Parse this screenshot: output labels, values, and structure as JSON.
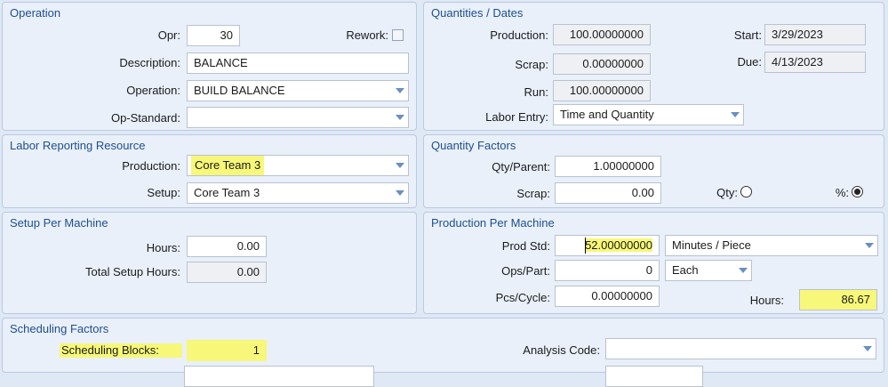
{
  "operation": {
    "title": "Operation",
    "opr_label": "Opr:",
    "opr_value": "30",
    "rework_label": "Rework:",
    "description_label": "Description:",
    "description_value": "BALANCE",
    "operation_label": "Operation:",
    "operation_value": "BUILD BALANCE",
    "op_standard_label": "Op-Standard:",
    "op_standard_value": ""
  },
  "quantities_dates": {
    "title": "Quantities / Dates",
    "production_label": "Production:",
    "production_value": "100.00000000",
    "scrap_label": "Scrap:",
    "scrap_value": "0.00000000",
    "run_label": "Run:",
    "run_value": "100.00000000",
    "labor_entry_label": "Labor Entry:",
    "labor_entry_value": "Time and Quantity",
    "start_label": "Start:",
    "start_value": "3/29/2023",
    "due_label": "Due:",
    "due_value": "4/13/2023"
  },
  "labor_reporting": {
    "title": "Labor Reporting Resource",
    "production_label": "Production:",
    "production_value": "Core Team 3",
    "setup_label": "Setup:",
    "setup_value": "Core Team 3"
  },
  "quantity_factors": {
    "title": "Quantity Factors",
    "qty_parent_label": "Qty/Parent:",
    "qty_parent_value": "1.00000000",
    "scrap_label": "Scrap:",
    "scrap_value": "0.00",
    "qty_label": "Qty:",
    "pct_label": "%:"
  },
  "setup_per_machine": {
    "title": "Setup Per Machine",
    "hours_label": "Hours:",
    "hours_value": "0.00",
    "total_setup_label": "Total Setup Hours:",
    "total_setup_value": "0.00"
  },
  "production_per_machine": {
    "title": "Production Per Machine",
    "prod_std_label": "Prod Std:",
    "prod_std_value": "52.00000000",
    "prod_std_unit": "Minutes / Piece",
    "ops_part_label": "Ops/Part:",
    "ops_part_value": "0",
    "ops_part_unit": "Each",
    "pcs_cycle_label": "Pcs/Cycle:",
    "pcs_cycle_value": "0.00000000",
    "hours_label": "Hours:",
    "hours_value": "86.67"
  },
  "scheduling": {
    "title": "Scheduling Factors",
    "blocks_label": "Scheduling Blocks:",
    "blocks_value": "1",
    "analysis_label": "Analysis Code:",
    "analysis_value": ""
  },
  "colors": {
    "highlight": "#f7f77a",
    "panel_title": "#1e4e8c",
    "panel_bg": "#e9f0fa"
  }
}
